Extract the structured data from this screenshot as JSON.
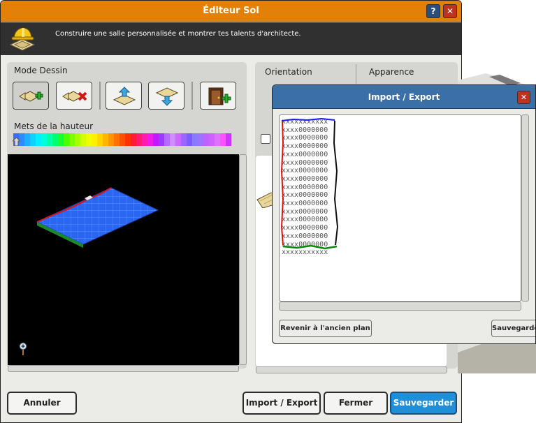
{
  "window": {
    "title": "Éditeur Sol",
    "help_label": "?",
    "close_label": "✕",
    "description": "Construire une salle personnalisée et montrer tes talents d'architecte."
  },
  "left_panel": {
    "mode_label": "Mets de la hauteur",
    "section_title": "Mode Dessin",
    "tools": [
      {
        "name": "add-tile-tool",
        "icon": "tile-plus-icon"
      },
      {
        "name": "remove-tile-tool",
        "icon": "tile-x-icon"
      },
      {
        "name": "raise-height-tool",
        "icon": "tile-up-icon"
      },
      {
        "name": "lower-height-tool",
        "icon": "tile-down-icon"
      },
      {
        "name": "door-tool",
        "icon": "door-plus-icon"
      }
    ],
    "height_palette": [
      "#3a6bff",
      "#2b8cff",
      "#1ab0ff",
      "#0bd2ff",
      "#00f0ff",
      "#00ffd8",
      "#00ffa6",
      "#00ff6e",
      "#18ff2c",
      "#4cff00",
      "#7dff00",
      "#a8ff00",
      "#d4ff00",
      "#f0ff00",
      "#fff000",
      "#ffd400",
      "#ffb400",
      "#ff9200",
      "#ff7000",
      "#ff4e00",
      "#ff3000",
      "#ff1a3a",
      "#ff1a74",
      "#ff1ab0",
      "#f01aea",
      "#c21aff",
      "#9a3aff",
      "#b36bff",
      "#d08cff",
      "#cc66ff",
      "#9966ff",
      "#7a5cff",
      "#8a7aff",
      "#a070ff",
      "#c060ff",
      "#d060ff",
      "#e070ff",
      "#ff50ff",
      "#cc33ff"
    ]
  },
  "right_panel": {
    "tab_orientation": "Orientation",
    "tab_appearance": "Apparence"
  },
  "footer": {
    "cancel": "Annuler",
    "import_export": "Import / Export",
    "close": "Fermer",
    "save": "Sauvegarder"
  },
  "popup": {
    "title": "Import / Export",
    "close_label": "✕",
    "map_lines": [
      "xxxxxxxxxxx",
      "xxxx0000000",
      "xxxx0000000",
      "xxxx0000000",
      "xxxx0000000",
      "xxxx0000000",
      "xxxx0000000",
      "xxxx0000000",
      "xxxx0000000",
      "xxxx0000000",
      "xxxx0000000",
      "xxxx0000000",
      "xxxx0000000",
      "xxxx0000000",
      "xxxx0000000",
      "xxxx0000000",
      "xxxxxxxxxxx"
    ],
    "revert_button": "Revenir à l'ancien plan",
    "save_button": "Sauvegarder"
  }
}
